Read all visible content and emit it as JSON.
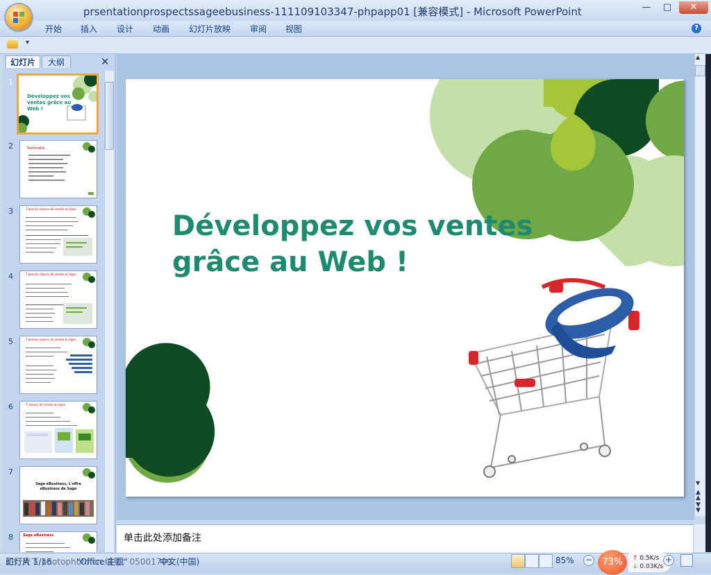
{
  "window": {
    "title": "prsentationprospectssageebusiness-111109103347-phpapp01 [兼容模式] - Microsoft PowerPoint",
    "minimize": "—",
    "maximize": "□",
    "close": "✕"
  },
  "ribbon": {
    "tabs": [
      "开始",
      "插入",
      "设计",
      "动画",
      "幻灯片放映",
      "审阅",
      "视图"
    ],
    "help": "?"
  },
  "quick_access": {
    "more": "▾"
  },
  "panel": {
    "tab_slides": "幻灯片",
    "tab_outline": "大纲",
    "close": "✕",
    "slide_numbers": [
      "1",
      "2",
      "3",
      "4",
      "5",
      "6",
      "7",
      "8"
    ]
  },
  "thumbs": {
    "t1_title": "Développez vos ventes grâce au Web !",
    "t2_title": "Sommaire",
    "t3_title": "7 bonnes raisons de vendre en ligne",
    "t4_title": "7 bonnes raisons de vendre en ligne",
    "t5_title": "7 bonnes raisons de vendre en ligne",
    "t6_title": "7 raisons de vendre en ligne",
    "t7_title": "Sage eBusiness, L'offre eBusiness de Sage",
    "t8_title": "Sage eBusiness"
  },
  "slide": {
    "title_line1": "Développez vos ventes",
    "title_line2": "grâce au Web !"
  },
  "notes": {
    "placeholder": "单击此处添加备注"
  },
  "status": {
    "slide_info": "幻灯片 1/16",
    "theme": "\"Office 主题\"",
    "language": "中文(中国)",
    "watermark": "图行天下 photophoto.cn 编号：05001709",
    "zoom": "85%",
    "zoom_minus": "−",
    "zoom_plus": "+",
    "cpu": "73%",
    "net_up": "0.5K/s",
    "net_down": "0.03K/s"
  },
  "colors": {
    "accent_green": "#1f8a6f",
    "light_green": "#c5dfa8",
    "mid_green": "#6fa845",
    "dark_green": "#0f4a22",
    "lime": "#a6c63a"
  }
}
